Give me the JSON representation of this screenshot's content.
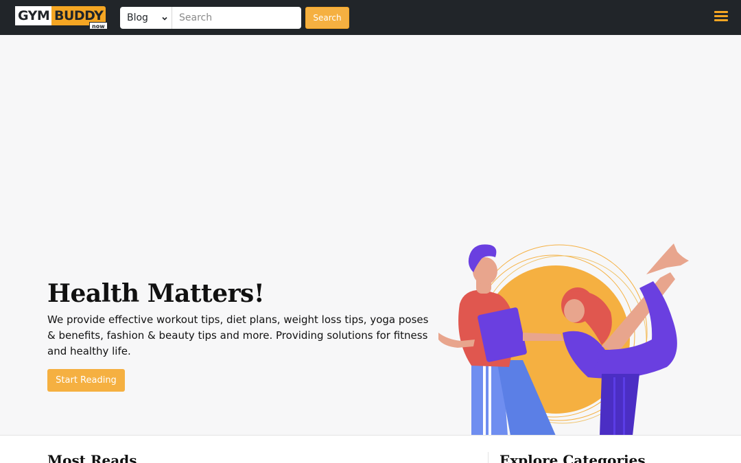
{
  "brand": {
    "logo_part1": "GYM",
    "logo_part2": "BUDDY",
    "logo_part3": "now",
    "accent": "#f5a623",
    "nav_bg": "#212529"
  },
  "search": {
    "category_selected": "Blog",
    "placeholder": "Search",
    "value": "",
    "button_label": "Search"
  },
  "nav": {
    "menu_icon": "hamburger-icon"
  },
  "hero": {
    "title": "Health Matters!",
    "description": "We provide effective workout tips, diet plans, weight loss tips, yoga poses & benefits, fashion & beauty tips and more. Providing solutions for fitness and healthy life.",
    "cta_label": "Start Reading",
    "illustration": "trainer-and-yoga-woman-illustration"
  },
  "sections": {
    "left_title": "Most Reads",
    "right_title": "Explore Categories"
  }
}
